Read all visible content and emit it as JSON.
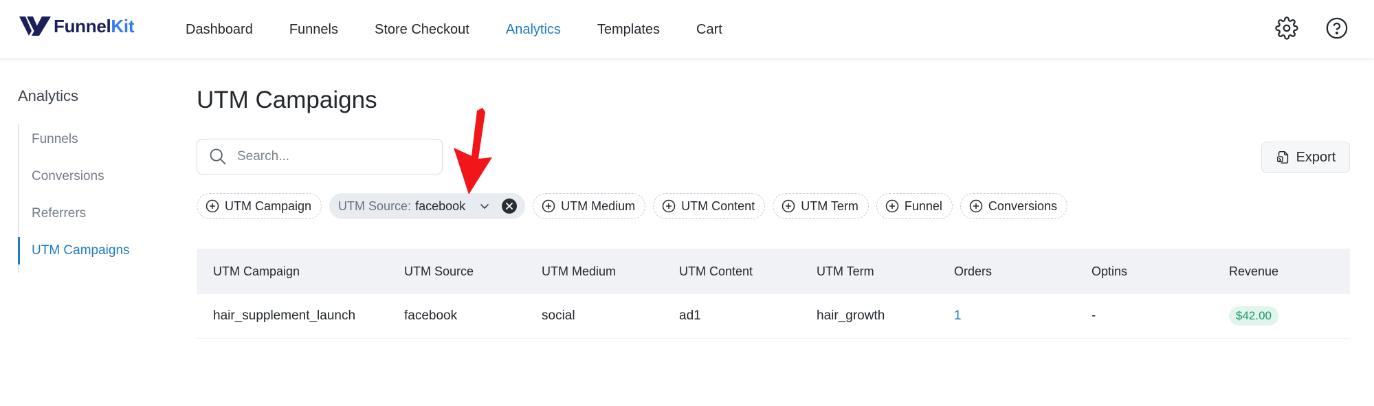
{
  "app": {
    "logo_part1": "Funnel",
    "logo_part2": "Kit",
    "brand_color": "#2f7cf5",
    "accent_color": "#1d7bc5"
  },
  "topnav": {
    "items": [
      {
        "label": "Dashboard",
        "active": false
      },
      {
        "label": "Funnels",
        "active": false
      },
      {
        "label": "Store Checkout",
        "active": false
      },
      {
        "label": "Analytics",
        "active": true
      },
      {
        "label": "Templates",
        "active": false
      },
      {
        "label": "Cart",
        "active": false
      }
    ],
    "icons": [
      "gear-icon",
      "help-icon"
    ]
  },
  "sidebar": {
    "title": "Analytics",
    "items": [
      {
        "label": "Funnels",
        "active": false
      },
      {
        "label": "Conversions",
        "active": false
      },
      {
        "label": "Referrers",
        "active": false
      },
      {
        "label": "UTM Campaigns",
        "active": true
      }
    ]
  },
  "main": {
    "title": "UTM Campaigns",
    "search": {
      "placeholder": "Search...",
      "value": ""
    },
    "export_label": "Export",
    "filters": {
      "utm_campaign": "UTM Campaign",
      "selected": {
        "label": "UTM Source:",
        "value": "facebook"
      },
      "utm_medium": "UTM Medium",
      "utm_content": "UTM Content",
      "utm_term": "UTM Term",
      "funnel": "Funnel",
      "conversions": "Conversions"
    },
    "table": {
      "headers": [
        "UTM Campaign",
        "UTM Source",
        "UTM Medium",
        "UTM Content",
        "UTM Term",
        "Orders",
        "Optins",
        "Revenue"
      ],
      "rows": [
        [
          "hair_supplement_launch",
          "facebook",
          "social",
          "ad1",
          "hair_growth",
          "1",
          "-",
          "$42.00"
        ]
      ]
    }
  }
}
